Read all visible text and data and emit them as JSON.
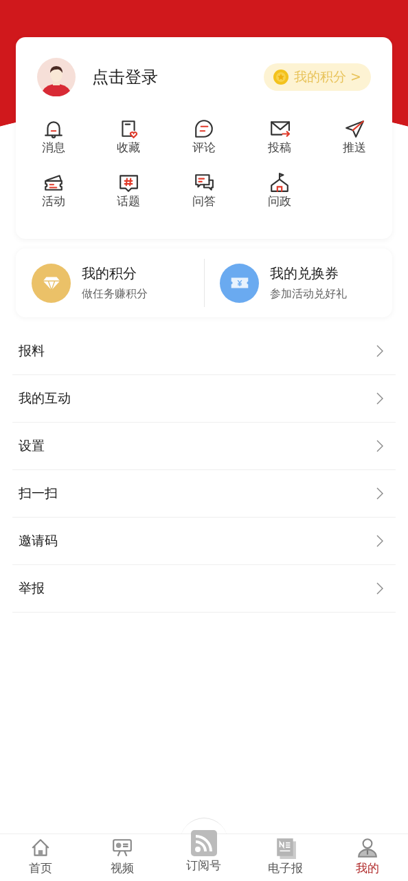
{
  "profile": {
    "login_text": "点击登录",
    "points_badge": "我的积分 >"
  },
  "shortcuts": [
    {
      "kind": "bell",
      "label": "消息"
    },
    {
      "kind": "favorite",
      "label": "收藏"
    },
    {
      "kind": "comment",
      "label": "评论"
    },
    {
      "kind": "mail",
      "label": "投稿"
    },
    {
      "kind": "send",
      "label": "推送"
    },
    {
      "kind": "ticket",
      "label": "活动"
    },
    {
      "kind": "topic",
      "label": "话题"
    },
    {
      "kind": "qa",
      "label": "问答"
    },
    {
      "kind": "building",
      "label": "问政"
    }
  ],
  "benefits": [
    {
      "kind": "diamond",
      "title": "我的积分",
      "subtitle": "做任务赚积分"
    },
    {
      "kind": "coupon",
      "title": "我的兑换券",
      "subtitle": "参加活动兑好礼"
    }
  ],
  "menu": [
    {
      "label": "报料"
    },
    {
      "label": "我的互动"
    },
    {
      "label": "设置"
    },
    {
      "label": "扫一扫"
    },
    {
      "label": "邀请码"
    },
    {
      "label": "举报"
    }
  ],
  "tab_bar": [
    {
      "kind": "home",
      "label": "首页",
      "selected": false
    },
    {
      "kind": "video",
      "label": "视频",
      "selected": false
    },
    {
      "kind": "rss",
      "label": "订阅号",
      "selected": false
    },
    {
      "kind": "paper",
      "label": "电子报",
      "selected": false
    },
    {
      "kind": "me",
      "label": "我的",
      "selected": true
    }
  ]
}
